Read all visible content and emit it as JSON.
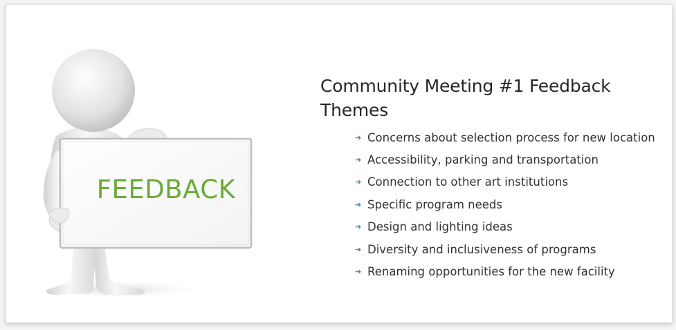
{
  "illustration": {
    "sign_text": "FEEDBACK",
    "sign_text_color": "#6aab38"
  },
  "title": "Community Meeting #1 Feedback Themes",
  "bullet_icon": "arrow-right-icon",
  "bullets": [
    "Concerns about selection process for new location",
    "Accessibility, parking and transportation",
    "Connection to other art institutions",
    "Specific program needs",
    "Design and lighting ideas",
    "Diversity and inclusiveness of programs",
    "Renaming opportunities for the new facility"
  ]
}
